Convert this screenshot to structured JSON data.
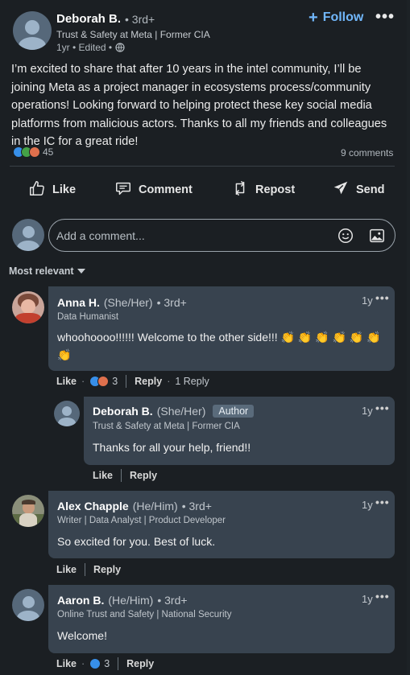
{
  "post": {
    "author_name": "Deborah B.",
    "degree": "• 3rd+",
    "headline": "Trust & Safety at Meta | Former CIA",
    "timestamp": "1yr • Edited •",
    "follow_label": "Follow",
    "more_label": "•••",
    "body": "I’m excited to share that after 10 years in the intel community, I’ll be joining Meta as a project manager in ecosystems process/community operations! Looking forward to helping protect these key social media platforms from malicious actors. Thanks to all my friends and colleagues in the IC for a great ride!",
    "reaction_count": "45",
    "comments_count": "9 comments"
  },
  "actions": {
    "like": "Like",
    "comment": "Comment",
    "repost": "Repost",
    "send": "Send"
  },
  "comment_box": {
    "placeholder": "Add a comment..."
  },
  "sort_label": "Most relevant",
  "comments": [
    {
      "name": "Anna H.",
      "pronouns": "(She/Her)",
      "degree": "• 3rd+",
      "headline": "Data Humanist",
      "time": "1y",
      "text": "whoohoooo!!!!!! Welcome to the other side!!! 👏 👏 👏 👏 👏 👏 👏",
      "like_label": "Like",
      "reaction_count": "3",
      "reply_label": "Reply",
      "replies_count": "1 Reply"
    },
    {
      "name": "Deborah B.",
      "pronouns": "(She/Her)",
      "author_tag": "Author",
      "headline": "Trust & Safety at Meta | Former CIA",
      "time": "1y",
      "text": "Thanks for all your help, friend!!",
      "like_label": "Like",
      "reply_label": "Reply"
    },
    {
      "name": "Alex Chapple",
      "pronouns": "(He/Him)",
      "degree": "• 3rd+",
      "headline": "Writer | Data Analyst | Product Developer",
      "time": "1y",
      "text": "So excited for you. Best of luck.",
      "like_label": "Like",
      "reply_label": "Reply"
    },
    {
      "name": "Aaron B.",
      "pronouns": "(He/Him)",
      "degree": "• 3rd+",
      "headline": "Online Trust and Safety | National Security",
      "time": "1y",
      "text": "Welcome!",
      "like_label": "Like",
      "reaction_count": "3",
      "reply_label": "Reply"
    }
  ],
  "colors": {
    "background": "#1b1f23",
    "comment_bubble": "#38434f",
    "follow_blue": "#71b7fb",
    "like_blue": "#378fe9",
    "celebrate_green": "#44a147",
    "love_red": "#df704d"
  }
}
